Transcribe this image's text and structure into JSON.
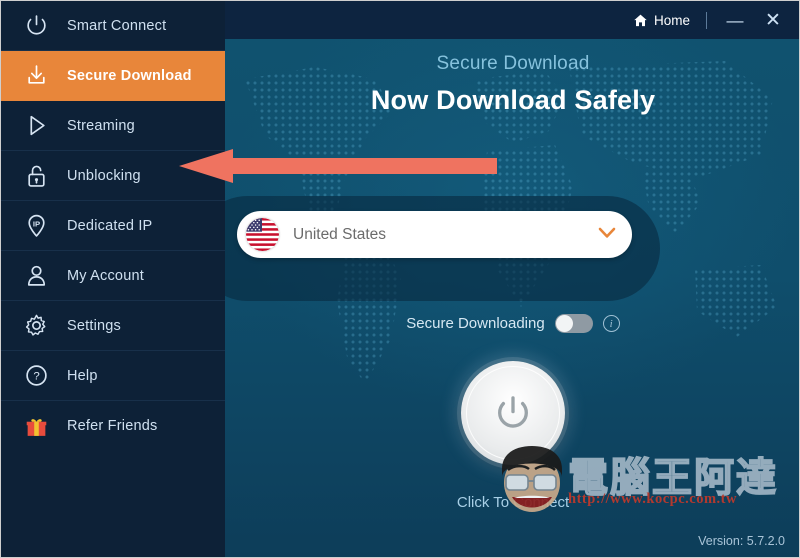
{
  "app": {
    "version_label": "Version:  5.7.2.0"
  },
  "titlebar": {
    "home_label": "Home",
    "minimize_label": "—",
    "close_label": "✕"
  },
  "sidebar": {
    "items": [
      {
        "id": "smart-connect",
        "label": "Smart Connect",
        "icon": "power-icon",
        "active": false
      },
      {
        "id": "secure-download",
        "label": "Secure Download",
        "icon": "download-icon",
        "active": true
      },
      {
        "id": "streaming",
        "label": "Streaming",
        "icon": "play-icon",
        "active": false
      },
      {
        "id": "unblocking",
        "label": "Unblocking",
        "icon": "unlock-icon",
        "active": false
      },
      {
        "id": "dedicated-ip",
        "label": "Dedicated IP",
        "icon": "ip-pin-icon",
        "active": false
      },
      {
        "id": "my-account",
        "label": "My Account",
        "icon": "user-icon",
        "active": false
      },
      {
        "id": "settings",
        "label": "Settings",
        "icon": "gear-icon",
        "active": false
      },
      {
        "id": "help",
        "label": "Help",
        "icon": "question-icon",
        "active": false
      },
      {
        "id": "refer-friends",
        "label": "Refer Friends",
        "icon": "gift-icon",
        "active": false
      }
    ]
  },
  "main": {
    "subtitle": "Secure Download",
    "title": "Now Download Safely",
    "country_selector": {
      "value": "United States",
      "flag": "us-flag-icon",
      "chevron": "chevron-down-icon"
    },
    "toggle": {
      "label": "Secure Downloading",
      "state": "off",
      "info": "i"
    },
    "power_button": {
      "icon": "power-icon",
      "caption": "Click To Connect"
    }
  },
  "annotation": {
    "arrow": "left-pointing-arrow",
    "arrow_color": "#ef7360"
  },
  "watermark": {
    "text": "電腦王阿達",
    "url": "http://www.kocpc.com.tw"
  },
  "colors": {
    "accent_orange": "#e8863a",
    "sidebar_bg": "#0d2137",
    "panel_bg": "#0f5272",
    "titlebar_bg": "#0d2440",
    "subtitle_blue": "#86c2dd",
    "annotation_red": "#ef7360"
  }
}
